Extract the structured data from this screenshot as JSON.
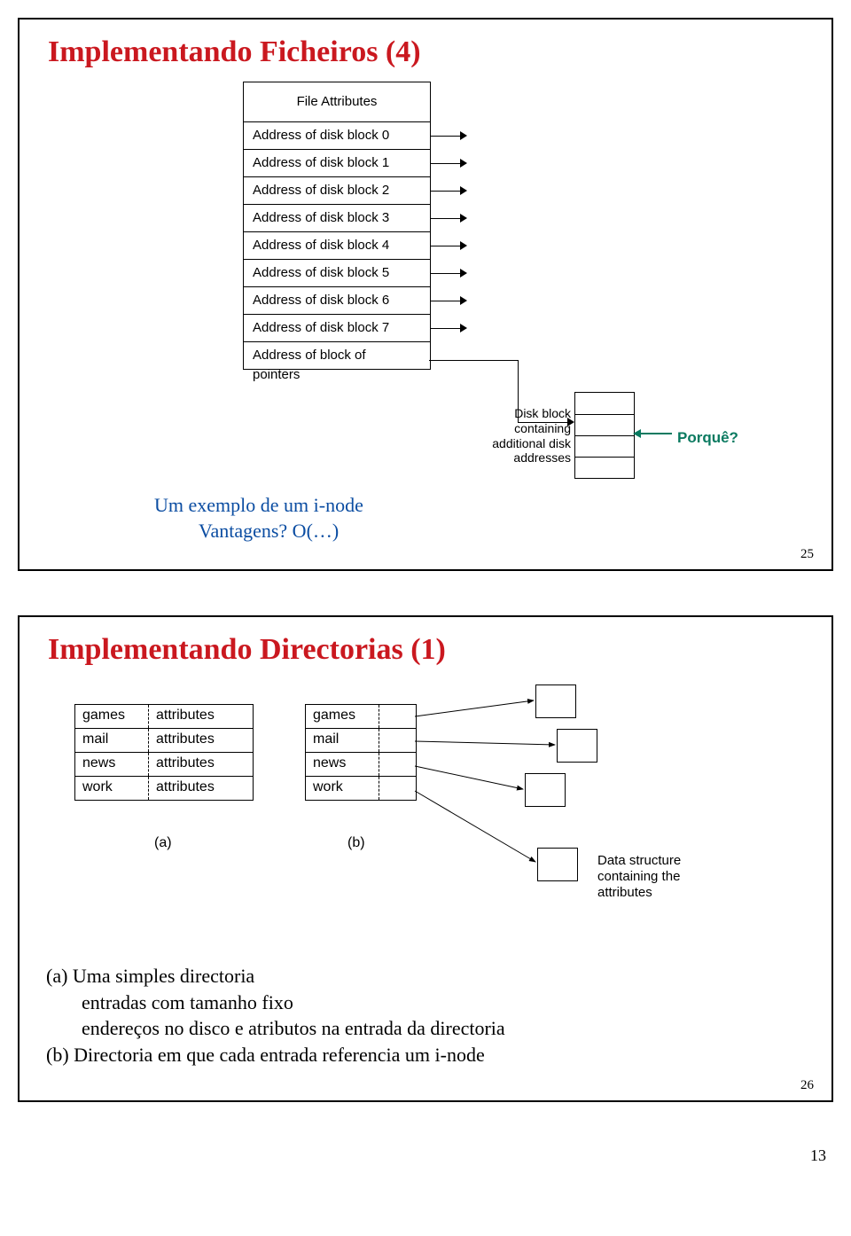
{
  "slide1": {
    "title": "Implementando Ficheiros (4)",
    "number": "25",
    "inode": {
      "header": "File Attributes",
      "rows": [
        "Address of disk block 0",
        "Address of disk block 1",
        "Address of disk block 2",
        "Address of disk block 3",
        "Address of disk block 4",
        "Address of disk block 5",
        "Address of disk block 6",
        "Address of disk block 7",
        "Address of block of pointers"
      ]
    },
    "disk_block_label": "Disk block containing additional disk addresses",
    "porque": "Porquê?",
    "caption_l1": "Um exemplo de um i-node",
    "caption_l2": "Vantagens? O(…)"
  },
  "slide2": {
    "title": "Implementando Directorias (1)",
    "number": "26",
    "dirA": {
      "names": [
        "games",
        "mail",
        "news",
        "work"
      ],
      "attr": "attributes"
    },
    "dirB": {
      "names": [
        "games",
        "mail",
        "news",
        "work"
      ]
    },
    "labelA": "(a)",
    "labelB": "(b)",
    "ds_label": "Data structure containing the attributes",
    "body_a": "(a) Uma simples directoria",
    "body_a2": "entradas com tamanho fixo",
    "body_a3": "endereços no disco e atributos na entrada da directoria",
    "body_b": "(b) Directoria em que cada entrada referencia um i-node"
  },
  "page_number": "13"
}
